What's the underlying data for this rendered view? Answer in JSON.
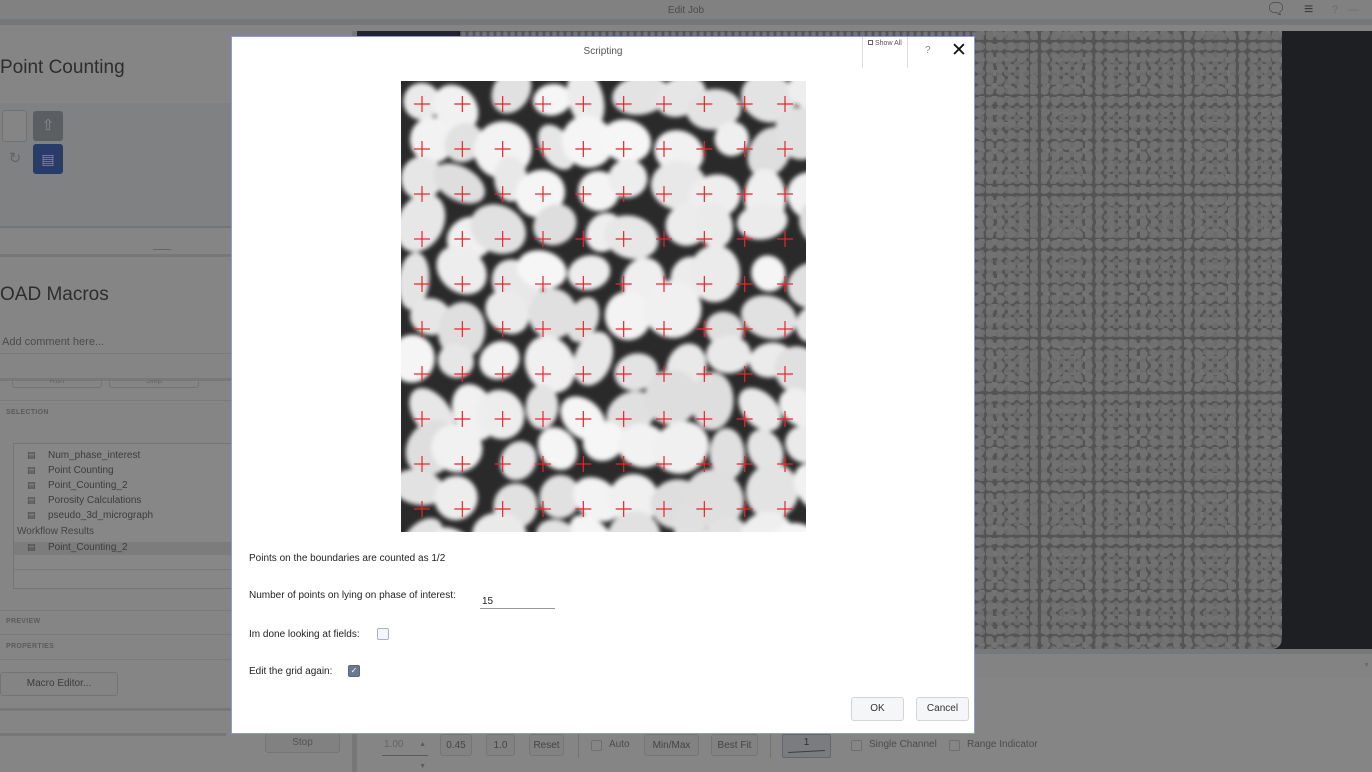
{
  "window": {
    "title": "Edit Job",
    "icons": [
      "comment-icon",
      "menu-icon"
    ],
    "help_label": "?",
    "minimize_label": "—"
  },
  "left_panel": {
    "panel1_title": "Point Counting",
    "toolbar_icons": [
      "upload-file-icon",
      "refresh-icon",
      "run-macro-icon"
    ],
    "panel2_title": "OAD Macros",
    "comment_placeholder": "Add comment here...",
    "run_label": "Run",
    "step_label": "Step",
    "sections": {
      "selection": "SELECTION",
      "preview": "PREVIEW",
      "properties": "PROPERTIES"
    },
    "macros": [
      "Num_phase_interest",
      "Point Counting",
      "Point_Counting_2",
      "Porosity Calculations",
      "pseudo_3d_micrograph"
    ],
    "workflow_results_label": "Workflow Results",
    "workflow_results": [
      "Point_Counting_2"
    ],
    "macro_editor_label": "Macro Editor...",
    "stop_label": "Stop"
  },
  "display_controls": {
    "gamma_value": "1.00",
    "gamma_preset_1": "0.45",
    "gamma_preset_2": "1.0",
    "reset_label": "Reset",
    "auto_label": "Auto",
    "auto_checked": false,
    "minmax_label": "Min/Max",
    "bestfit_label": "Best Fit",
    "channel_value": "1",
    "single_channel_label": "Single Channel",
    "single_channel_checked": false,
    "range_indicator_label": "Range Indicator",
    "range_indicator_checked": false
  },
  "dialog": {
    "title": "Scripting",
    "show_all_label": "Show All",
    "help_label": "?",
    "close_label": "✕",
    "grid": {
      "columns": 10,
      "rows": 10,
      "marker": "+",
      "marker_color": "#e8242b"
    },
    "note": "Points on the boundaries are counted as 1/2",
    "points_label": "Number of points on lying on phase of interest:",
    "points_value": "15",
    "done_label": "Im done looking at fields:",
    "done_checked": false,
    "edit_grid_label": "Edit the grid again:",
    "edit_grid_checked": true,
    "ok_label": "OK",
    "cancel_label": "Cancel"
  }
}
